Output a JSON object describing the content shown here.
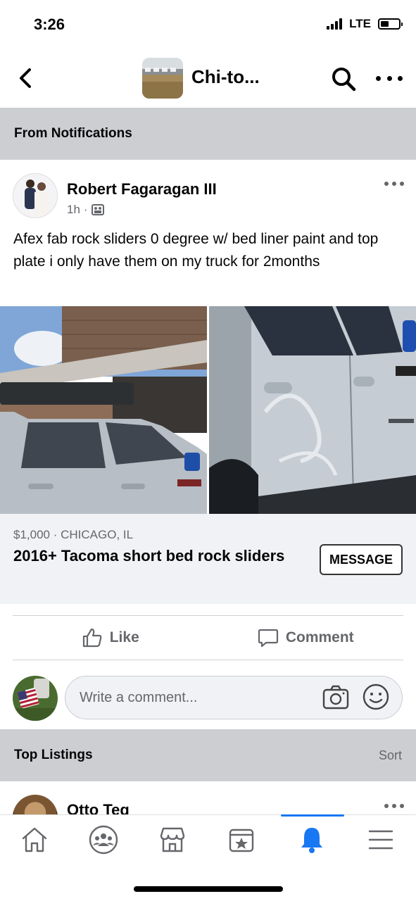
{
  "status_bar": {
    "time": "3:26",
    "network": "LTE",
    "battery_level": 0.45
  },
  "top_nav": {
    "group_title": "Chi-to..."
  },
  "notification_section": {
    "title": "From Notifications"
  },
  "post": {
    "author": "Robert Fagaragan III",
    "time": "1h",
    "separator": "·",
    "text": "Afex fab rock sliders 0 degree w/ bed liner paint and top plate i only have them on my truck for 2months",
    "listing": {
      "meta": "$1,000 · CHICAGO, IL",
      "title": "2016+ Tacoma short bed rock sliders",
      "message_label": "MESSAGE"
    },
    "actions": {
      "like_label": "Like",
      "comment_label": "Comment"
    },
    "comment_placeholder": "Write a comment..."
  },
  "top_listings": {
    "title": "Top Listings",
    "sort_label": "Sort"
  },
  "next_post": {
    "author": "Otto Teg"
  },
  "bottom_nav": {
    "tabs": [
      "home-icon",
      "groups-icon",
      "marketplace-icon",
      "pages-icon",
      "notifications-icon",
      "menu-icon"
    ],
    "active_tab": "notifications-icon",
    "active_color": "#1877f2"
  }
}
